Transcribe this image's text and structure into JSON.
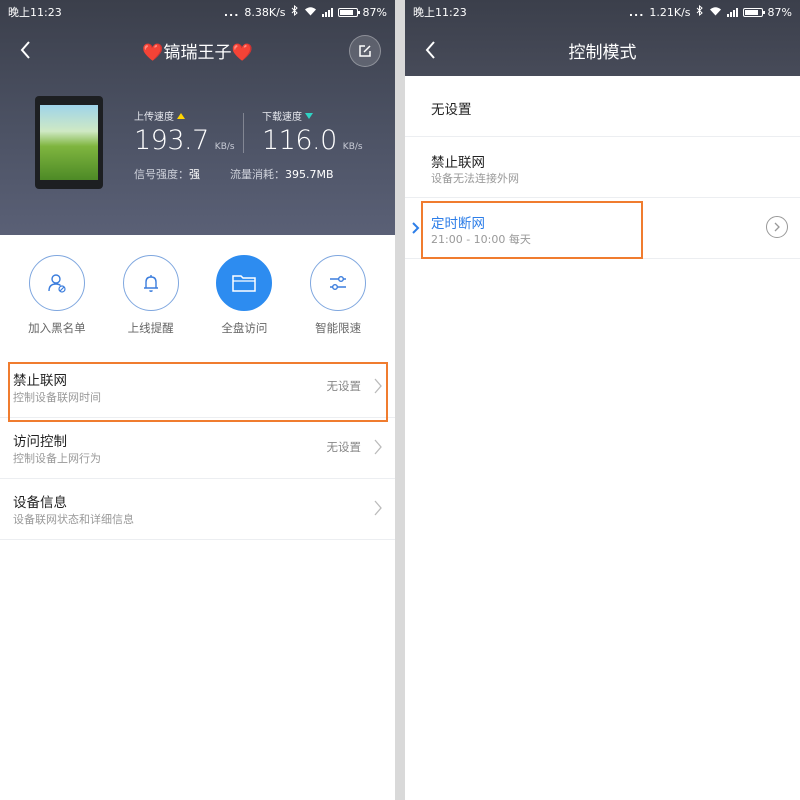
{
  "left": {
    "status": {
      "time": "晚上11:23",
      "speed": "8.38K/s",
      "battery": "87%"
    },
    "header": {
      "title": "❤️镐瑞王子❤️",
      "upload_label": "上传速度",
      "upload_value": "193.7",
      "upload_unit": "KB/s",
      "download_label": "下载速度",
      "download_value": "116.0",
      "download_unit": "KB/s",
      "signal_label": "信号强度：",
      "signal_value": "强",
      "traffic_label": "流量消耗：",
      "traffic_value": "395.7MB"
    },
    "actions": [
      {
        "label": "加入黑名单",
        "icon": "user-block-icon"
      },
      {
        "label": "上线提醒",
        "icon": "bell-icon"
      },
      {
        "label": "全盘访问",
        "icon": "folder-icon"
      },
      {
        "label": "智能限速",
        "icon": "sliders-icon"
      }
    ],
    "rows": [
      {
        "title": "禁止联网",
        "subtitle": "控制设备联网时间",
        "value": "无设置"
      },
      {
        "title": "访问控制",
        "subtitle": "控制设备上网行为",
        "value": "无设置"
      },
      {
        "title": "设备信息",
        "subtitle": "设备联网状态和详细信息",
        "value": ""
      }
    ]
  },
  "right": {
    "status": {
      "time": "晚上11:23",
      "speed": "1.21K/s",
      "battery": "87%"
    },
    "title": "控制模式",
    "options": [
      {
        "title": "无设置",
        "subtitle": ""
      },
      {
        "title": "禁止联网",
        "subtitle": "设备无法连接外网"
      },
      {
        "title": "定时断网",
        "subtitle": "21:00 - 10:00 每天"
      }
    ]
  },
  "colors": {
    "accent": "#2d8cf0",
    "highlight": "#f07c2f",
    "header": "#454a59"
  }
}
